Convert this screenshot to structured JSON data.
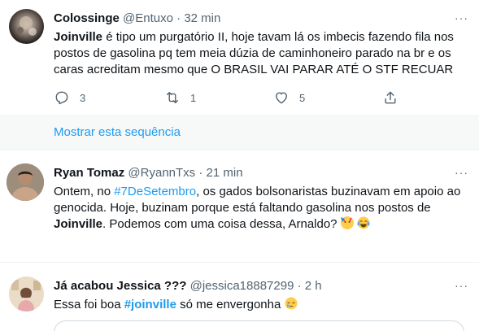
{
  "tweets": [
    {
      "name": "Colossinge",
      "handle": "@Entuxo",
      "separator": "·",
      "time": "32 min",
      "body": {
        "bold_start": "Joinville",
        "line1_rest": " é tipo um purgatório II, hoje tavam lá os imbecis fazendo fila nos",
        "line2": "postos de gasolina pq tem meia dúzia de caminhoneiro parado na br e os",
        "line3": "caras acreditam mesmo que O BRASIL VAI PARAR ATÉ O STF RECUAR"
      },
      "reply_count": "3",
      "retweet_count": "1",
      "like_count": "5",
      "more_label": "···"
    },
    {
      "name": "Ryan Tomaz",
      "handle": "@RyannTxs",
      "separator": "·",
      "time": "21 min",
      "body": {
        "line1_a": "Ontem, no ",
        "hashtag": "#7DeSetembro",
        "line1_b": ", os gados bolsonaristas buzinavam em apoio ao",
        "line2": "genocida. Hoje, buzinam porque está faltando gasolina nos postos de",
        "bold_word": "Joinville",
        "line3_rest": ". Podemos com uma coisa dessa, Arnaldo?"
      },
      "emojis": [
        "party-face-emoji",
        "tears-of-joy-emoji"
      ],
      "more_label": "···"
    },
    {
      "name": "Já acabou Jessica ???",
      "handle": "@jessica18887299",
      "separator": "·",
      "time": "2 h",
      "body": {
        "text_a": "Essa foi boa ",
        "hashtag": "#joinville",
        "text_b": " só me envergonha"
      },
      "emojis": [
        "sleepy-face-emoji"
      ],
      "more_label": "···"
    }
  ],
  "show_thread": "Mostrar esta sequência",
  "colors": {
    "accent": "#1d9bf0",
    "text": "#0f1419",
    "secondary": "#536471",
    "thread_bg": "#f7f9f9"
  }
}
